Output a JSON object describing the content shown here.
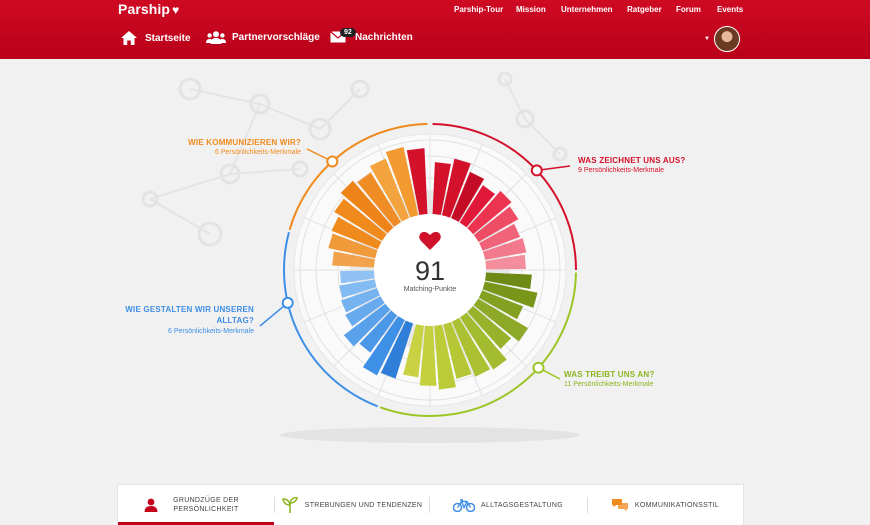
{
  "brand": {
    "name": "Parship"
  },
  "top_nav": [
    "Parship-Tour",
    "Mission",
    "Unternehmen",
    "Ratgeber",
    "Forum",
    "Events"
  ],
  "sub_nav": {
    "home": "Startseite",
    "partners": "Partnervorschläge",
    "messages": "Nachrichten",
    "messages_count": "92"
  },
  "score": {
    "value": "91",
    "label": "Matching-Punkte"
  },
  "categories": [
    {
      "title": "WIE KOMMUNIZIEREN WIR?",
      "subtitle": "6 Persönlichkeits-Merkmale",
      "color": "#f08a1c"
    },
    {
      "title": "WAS ZEICHNET UNS AUS?",
      "subtitle": "9 Persönlichkeits-Merkmale",
      "color": "#d4112b"
    },
    {
      "title": "WIE GESTALTEN WIR UNSEREN ALLTAG?",
      "subtitle": "6 Persönlichkeits-Merkmale",
      "color": "#3e8fe6"
    },
    {
      "title": "WAS TREIBT UNS AN?",
      "subtitle": "11 Persönlichkeits-Merkmale",
      "color": "#8cb520"
    }
  ],
  "tabs": [
    {
      "label": "GRUNDZÜGE DER PERSÖNLICHKEIT",
      "icon": "person-icon",
      "active": true
    },
    {
      "label": "STREBUNGEN UND TENDENZEN",
      "icon": "plant-icon",
      "active": false
    },
    {
      "label": "ALLTAGSGESTALTUNG",
      "icon": "bicycle-icon",
      "active": false
    },
    {
      "label": "KOMMUNIKATIONSSTIL",
      "icon": "speech-bubbles-icon",
      "active": false
    }
  ],
  "colors": {
    "brand_red": "#c4001a",
    "orange": "#f08a1c",
    "red": "#d4112b",
    "pink": "#f07d8e",
    "olive": "#6f8a14",
    "lime": "#9cc527",
    "blue": "#3e8fe6"
  }
}
